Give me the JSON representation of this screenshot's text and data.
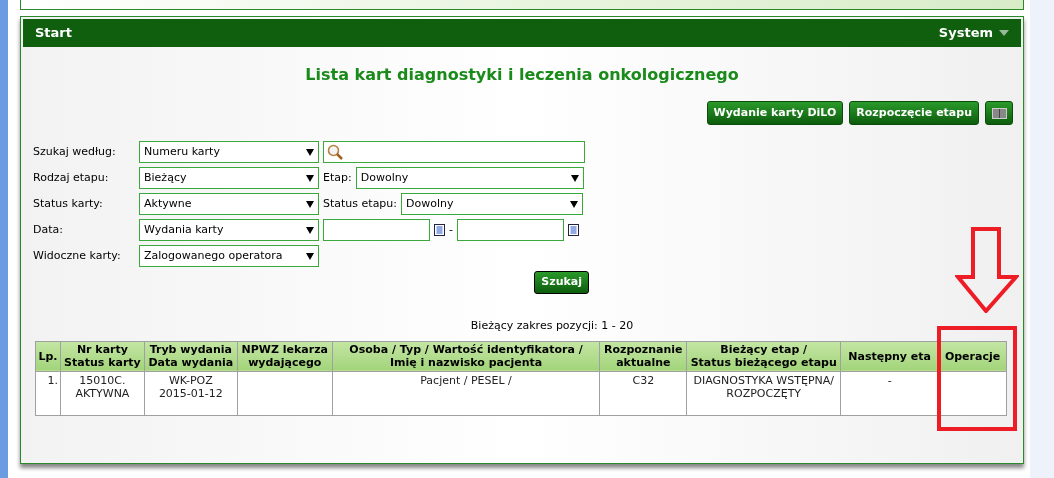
{
  "nav": {
    "left": "Start",
    "right": "System"
  },
  "title": "Lista kart diagnostyki i leczenia onkologicznego",
  "actions": [
    {
      "kind": "text",
      "label": "Wydanie karty DiLO"
    },
    {
      "kind": "text",
      "label": "Rozpoczęcie etapu"
    },
    {
      "kind": "barcode"
    }
  ],
  "filters": [
    {
      "label": "Szukaj według:",
      "value": "Numeru karty",
      "extra": {
        "kind": "search"
      }
    },
    {
      "label": "Rodzaj etapu:",
      "value": "Bieżący",
      "extra": {
        "kind": "select",
        "label": "Etap:",
        "value": "Dowolny"
      }
    },
    {
      "label": "Status karty:",
      "value": "Aktywne",
      "extra": {
        "kind": "select",
        "label": "Status etapu:",
        "value": "Dowolny"
      }
    },
    {
      "label": "Data:",
      "value": "Wydania karty",
      "extra": {
        "kind": "daterange",
        "separator": "-"
      }
    },
    {
      "label": "Widoczne karty:",
      "value": "Zalogowanego operatora"
    }
  ],
  "search_button": "Szukaj",
  "range": "Bieżący zakres pozycji: 1 - 20",
  "table": {
    "columns": [
      "Lp.",
      "Nr karty\nStatus karty",
      "Tryb wydania\nData wydania",
      "NPWZ lekarza\nwydającego",
      "Osoba / Typ / Wartość identyfikatora /\nImię i nazwisko pacjenta",
      "Rozpoznanie\naktualne",
      "Bieżący etap /\nStatus bieżącego etapu",
      "Następny eta",
      "Operacje"
    ],
    "rows": [
      [
        "1.",
        "15010C.\nAKTYWNA",
        "WK-POZ\n2015-01-12",
        "",
        "Pacjent / PESEL /",
        "C32",
        "DIAGNOSTYKA WSTĘPNA/\nROZPOCZĘTY",
        "-",
        ""
      ]
    ]
  }
}
